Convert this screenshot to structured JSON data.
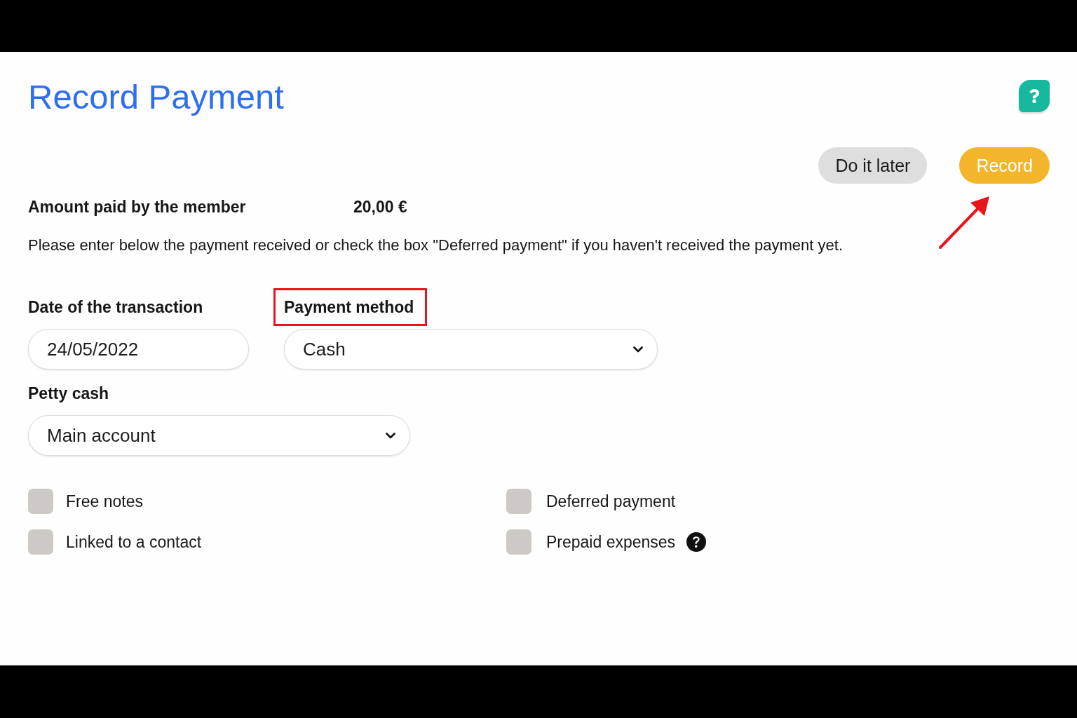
{
  "page": {
    "title": "Record Payment"
  },
  "actions": [
    {
      "label": "Do it later",
      "kind": "secondary",
      "pointed_at": false
    },
    {
      "label": "Record",
      "kind": "primary",
      "pointed_at": true
    }
  ],
  "amount": {
    "label": "Amount paid by the member",
    "value": "20,00 €"
  },
  "instructions": "Please enter below the payment received or check the box \"Deferred payment\" if you haven't received the payment yet.",
  "fields": [
    {
      "label": "Date of the transaction",
      "kind": "input",
      "value": "24/05/2022",
      "highlighted": false
    },
    {
      "label": "Payment method",
      "kind": "select",
      "value": "Cash",
      "highlighted": true
    },
    {
      "label": "Petty cash",
      "kind": "select",
      "value": "Main account",
      "highlighted": false
    }
  ],
  "options": [
    {
      "label": "Free notes",
      "checked": false,
      "help": false
    },
    {
      "label": "Deferred payment",
      "checked": false,
      "help": false
    },
    {
      "label": "Linked to a contact",
      "checked": false,
      "help": false
    },
    {
      "label": "Prepaid expenses",
      "checked": false,
      "help": true
    }
  ]
}
